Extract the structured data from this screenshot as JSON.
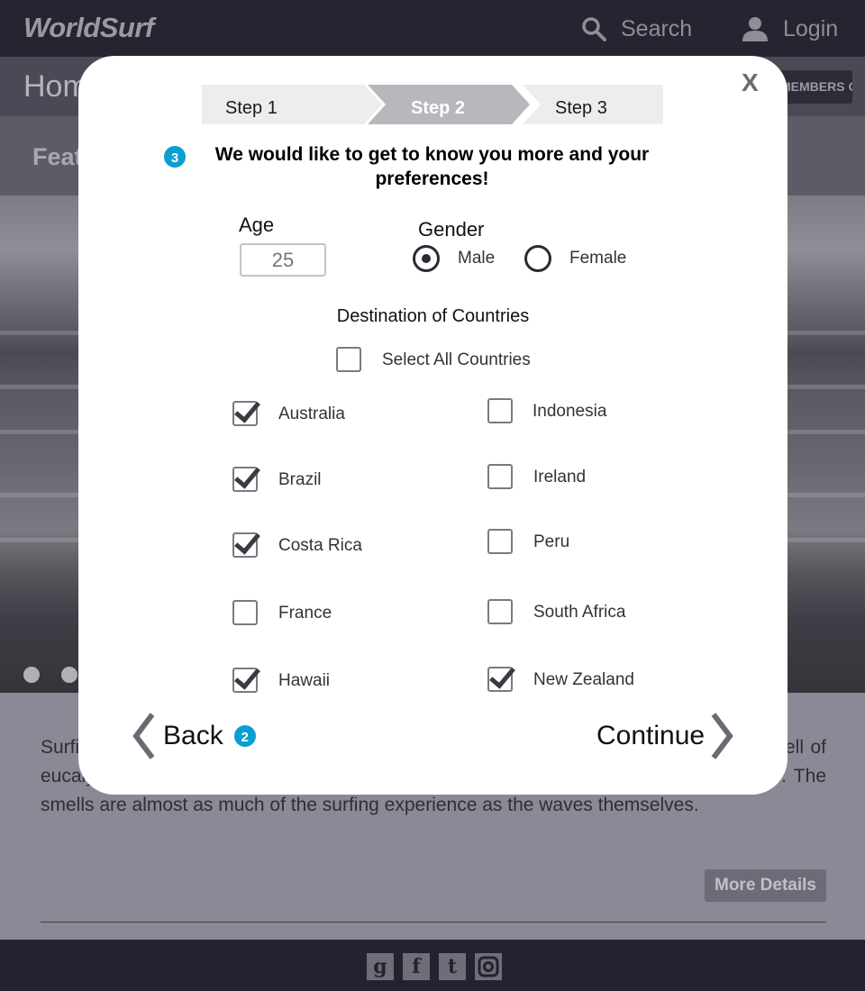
{
  "header": {
    "logo": "WorldSurf",
    "search_label": "Search",
    "login_label": "Login"
  },
  "subbar": {
    "title": "Home",
    "members_button": "MEMBERS ONLY"
  },
  "featured": {
    "title": "Featured"
  },
  "article": {
    "text": "Surfing smells great. Near the water in Southern California, the sage brush and the smell of eucalyptus wafts out to the lineup and in Hawaii, the plumeria kicks in with the trades. The smells are almost as much of the surfing experience as the waves themselves.",
    "more_details": "More Details"
  },
  "footer": {
    "social_icons": [
      "google-plus-icon",
      "facebook-icon",
      "twitter-icon",
      "instagram-icon"
    ]
  },
  "modal": {
    "close_label": "X",
    "steps": [
      {
        "label": "Step 1",
        "active": false
      },
      {
        "label": "Step 2",
        "active": true
      },
      {
        "label": "Step 3",
        "active": false
      }
    ],
    "heading_badge": "3",
    "heading": "We would like to get to know you more and your preferences!",
    "age_label": "Age",
    "age_placeholder": "25",
    "gender_label": "Gender",
    "gender_options": [
      {
        "label": "Male",
        "selected": true
      },
      {
        "label": "Female",
        "selected": false
      }
    ],
    "destination_title": "Destination of Countries",
    "select_all_label": "Select All Countries",
    "select_all_checked": false,
    "countries": [
      {
        "label": "Australia",
        "checked": true
      },
      {
        "label": "Brazil",
        "checked": true
      },
      {
        "label": "Costa Rica",
        "checked": true
      },
      {
        "label": "France",
        "checked": false
      },
      {
        "label": "Hawaii",
        "checked": true
      },
      {
        "label": "Indonesia",
        "checked": false
      },
      {
        "label": "Ireland",
        "checked": false
      },
      {
        "label": "Peru",
        "checked": false
      },
      {
        "label": "South Africa",
        "checked": false
      },
      {
        "label": "New Zealand",
        "checked": true
      }
    ],
    "back_label": "Back",
    "back_badge": "2",
    "continue_label": "Continue"
  },
  "colors": {
    "accent": "#0a9fd0",
    "overlay": "#252532",
    "modal_bg": "#ffffff"
  }
}
